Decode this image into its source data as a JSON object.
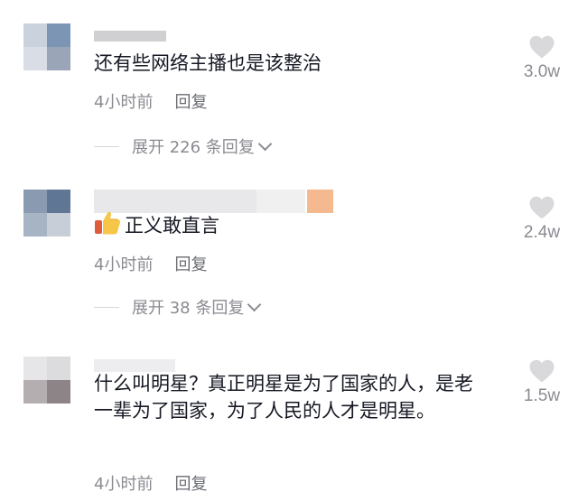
{
  "comments": [
    {
      "text": "还有些网络主播也是该整治",
      "time": "4小时前",
      "reply_label": "回复",
      "expand_label": "展开 226 条回复",
      "likes": "3.0w"
    },
    {
      "text": "正义敢直言",
      "emoji": "thumbs-up-emoji",
      "time": "4小时前",
      "reply_label": "回复",
      "expand_label": "展开 38 条回复",
      "likes": "2.4w"
    },
    {
      "text": "什么叫明星？真正明星是为了国家的人，是老一辈为了国家，为了人民的人才是明星。",
      "time": "4小时前",
      "reply_label": "回复",
      "likes": "1.5w"
    }
  ],
  "icons": {
    "like": "heart-icon",
    "expand": "chevron-down-icon"
  },
  "colors": {
    "meta_gray": "#8a8b91",
    "heart": "#d9d9dc"
  }
}
